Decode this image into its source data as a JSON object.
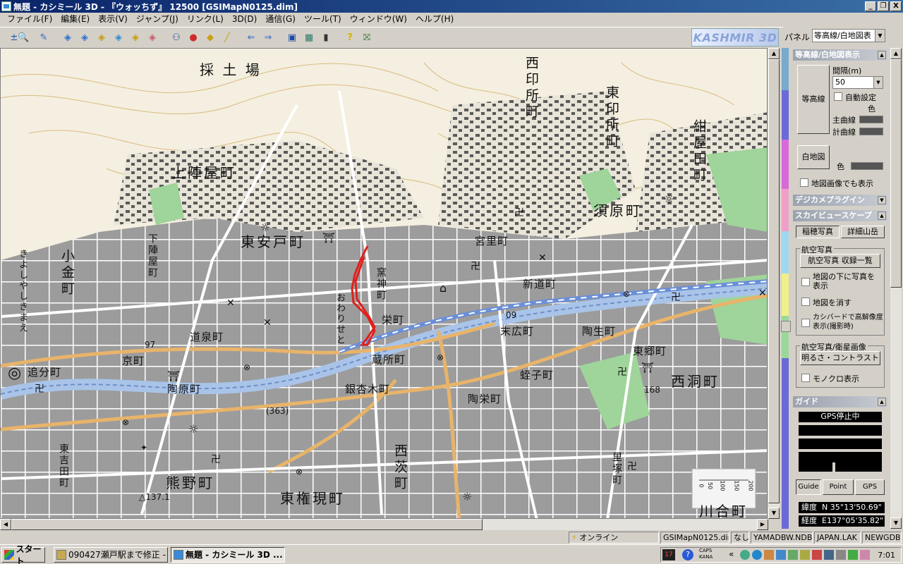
{
  "window": {
    "title": "無題 - カシミール 3D - 『ウォッちず』 12500 [GSIMapN0125.dim]",
    "minimize": "_",
    "restore": "❐",
    "close": "X"
  },
  "menu": [
    "ファイル(F)",
    "編集(E)",
    "表示(V)",
    "ジャンプ(J)",
    "リンク(L)",
    "3D(D)",
    "通信(G)",
    "ツール(T)",
    "ウィンドウ(W)",
    "ヘルプ(H)"
  ],
  "toolbar": {
    "brand": "KASHMIR 3D",
    "panel_label": "パネル",
    "panel_select": "等高線/白地図表"
  },
  "map": {
    "labels": {
      "saidoba": "採 土 場",
      "nishiinjo": "西印所町",
      "higashiinjo": "東印所町",
      "konyada": "紺屋田町",
      "kamijinya": "上陣屋町",
      "sugahara": "須原町",
      "higashiando": "東安戸町",
      "shimojinya": "下陣屋町",
      "kogane": "小金町",
      "kiyoshiyashikimae": "きよしやしきまえ",
      "kamagamicho": "窯神町",
      "owarise": "おわりせと",
      "miyasato": "宮里町",
      "shindo": "新道町",
      "sakae": "栄町",
      "suehiro": "末広町",
      "tosei": "陶生町",
      "higashigo": "東郷町",
      "nishibora": "西洞町",
      "dosen": "道泉町",
      "oiwake": "追分町",
      "kyomachi": "京町",
      "kurasho": "蔵所町",
      "tohara": "陶原町",
      "ginkyoki": "銀杏木町",
      "tosaka": "蛭子町",
      "toei": "陶栄町",
      "higashiyoshida": "東吉田町",
      "nishiibaraki": "西茨町",
      "kumano": "熊野町",
      "higashigongen": "東権現町",
      "kawai": "川合町",
      "satotsuka": "里塚町",
      "route97": "97",
      "route363": "(363)",
      "elev137": "△137.1",
      "elev168": "168",
      "station09": "09"
    },
    "scale_ticks": [
      "200",
      "150",
      "100",
      "50",
      "0"
    ],
    "route_color": "#e0201c"
  },
  "panel": {
    "contour_header": "等高線/白地図表示",
    "interval_label": "間隔(m)",
    "interval_value": "50",
    "contour_button": "等高線",
    "auto_setting": "自動設定",
    "color_label": "色",
    "main_line": "主曲線",
    "sub_line": "計曲線",
    "whitemap_button": "白地図",
    "whitemap_color": "色",
    "show_with_image": "地図画像でも表示",
    "digicam_header": "デジカメプラグイン",
    "skyview_header": "スカイビュースケープ",
    "tab_inaho": "稲穂写真",
    "tab_shosai": "詳細山岳",
    "aerial_group": "航空写真",
    "aerial_list_button": "航空写真 収録一覧",
    "under_map": "地図の下に写真を表示",
    "hide_map": "地図を消す",
    "cashmir_hd": "カシバードで高解像度表示(撮影時)",
    "sat_group": "航空写真/衛星画像",
    "brightness_button": "明るさ・コントラスト",
    "mono": "モノクロ表示",
    "guide_header": "ガイド",
    "gps_status": "GPS停止中",
    "tab_guide": "Guide",
    "tab_point": "Point",
    "tab_gps": "GPS",
    "lat_label": "緯度",
    "lat_value": "N 35°13'50.69\"",
    "lon_label": "経度",
    "lon_value": "E137°05'35.82\""
  },
  "status": {
    "online": "オンライン",
    "file": "GSIMapN0125.dim",
    "nashi": "なし",
    "db": "YAMADBW.NDB",
    "lak": "JAPAN.LAK",
    "gdb": "NEWGDB"
  },
  "taskbar": {
    "start": "スタート",
    "item1": "090427瀬戸駅まで修正 - ...",
    "item2": "無題 - カシミール 3D ...",
    "caps": "CAPS",
    "kana": "KANA",
    "clock": "7:01"
  }
}
